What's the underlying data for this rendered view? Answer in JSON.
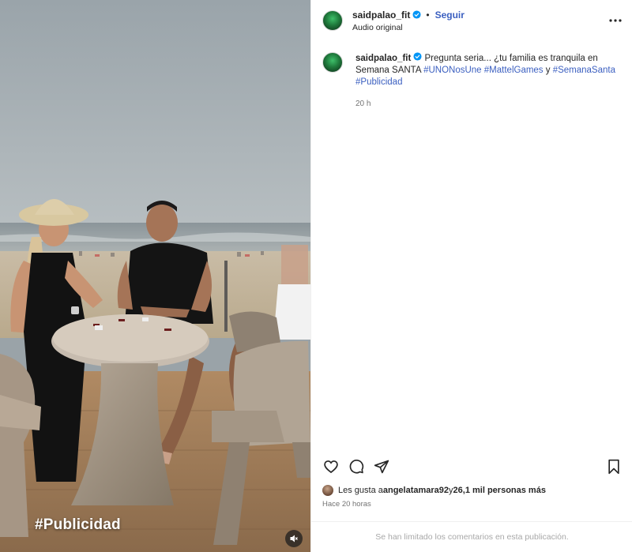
{
  "post": {
    "username": "saidpalao_fit",
    "separator": "•",
    "follow_label": "Seguir",
    "audio_label": "Audio original",
    "caption": {
      "username": "saidpalao_fit",
      "text": " Pregunta seria... ¿tu familia es tranquila en Semana SANTA ",
      "hashtags": [
        "#UNONosUne",
        "#MattelGames",
        "#SemanaSanta",
        "#Publicidad"
      ],
      "connector": " y ",
      "time": "20 h"
    },
    "media": {
      "overlay_text": "#Publicidad"
    },
    "likes": {
      "prefix": "Les gusta a ",
      "user": "angelatamara92",
      "middle": " y ",
      "count": "26,1 mil personas más"
    },
    "posted": "Hace 20 horas",
    "comments_notice": "Se han limitado los comentarios en esta publicación."
  },
  "colors": {
    "link": "#3b5fc0",
    "verified": "#0095f6",
    "muted_text": "#737373"
  },
  "icons": {
    "more": "more-horizontal-icon",
    "like": "heart-icon",
    "comment": "comment-icon",
    "share": "share-icon",
    "save": "bookmark-icon",
    "mute": "speaker-muted-icon"
  }
}
